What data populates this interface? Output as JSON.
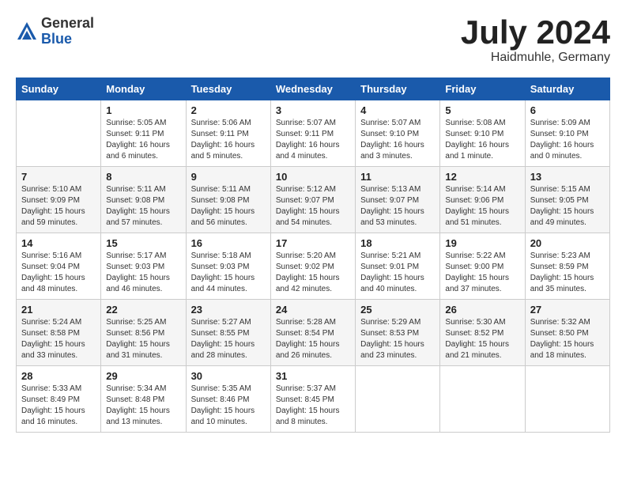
{
  "logo": {
    "general": "General",
    "blue": "Blue"
  },
  "title": {
    "month": "July 2024",
    "location": "Haidmuhle, Germany"
  },
  "headers": [
    "Sunday",
    "Monday",
    "Tuesday",
    "Wednesday",
    "Thursday",
    "Friday",
    "Saturday"
  ],
  "weeks": [
    [
      {
        "day": "",
        "info": ""
      },
      {
        "day": "1",
        "info": "Sunrise: 5:05 AM\nSunset: 9:11 PM\nDaylight: 16 hours\nand 6 minutes."
      },
      {
        "day": "2",
        "info": "Sunrise: 5:06 AM\nSunset: 9:11 PM\nDaylight: 16 hours\nand 5 minutes."
      },
      {
        "day": "3",
        "info": "Sunrise: 5:07 AM\nSunset: 9:11 PM\nDaylight: 16 hours\nand 4 minutes."
      },
      {
        "day": "4",
        "info": "Sunrise: 5:07 AM\nSunset: 9:10 PM\nDaylight: 16 hours\nand 3 minutes."
      },
      {
        "day": "5",
        "info": "Sunrise: 5:08 AM\nSunset: 9:10 PM\nDaylight: 16 hours\nand 1 minute."
      },
      {
        "day": "6",
        "info": "Sunrise: 5:09 AM\nSunset: 9:10 PM\nDaylight: 16 hours\nand 0 minutes."
      }
    ],
    [
      {
        "day": "7",
        "info": "Sunrise: 5:10 AM\nSunset: 9:09 PM\nDaylight: 15 hours\nand 59 minutes."
      },
      {
        "day": "8",
        "info": "Sunrise: 5:11 AM\nSunset: 9:08 PM\nDaylight: 15 hours\nand 57 minutes."
      },
      {
        "day": "9",
        "info": "Sunrise: 5:11 AM\nSunset: 9:08 PM\nDaylight: 15 hours\nand 56 minutes."
      },
      {
        "day": "10",
        "info": "Sunrise: 5:12 AM\nSunset: 9:07 PM\nDaylight: 15 hours\nand 54 minutes."
      },
      {
        "day": "11",
        "info": "Sunrise: 5:13 AM\nSunset: 9:07 PM\nDaylight: 15 hours\nand 53 minutes."
      },
      {
        "day": "12",
        "info": "Sunrise: 5:14 AM\nSunset: 9:06 PM\nDaylight: 15 hours\nand 51 minutes."
      },
      {
        "day": "13",
        "info": "Sunrise: 5:15 AM\nSunset: 9:05 PM\nDaylight: 15 hours\nand 49 minutes."
      }
    ],
    [
      {
        "day": "14",
        "info": "Sunrise: 5:16 AM\nSunset: 9:04 PM\nDaylight: 15 hours\nand 48 minutes."
      },
      {
        "day": "15",
        "info": "Sunrise: 5:17 AM\nSunset: 9:03 PM\nDaylight: 15 hours\nand 46 minutes."
      },
      {
        "day": "16",
        "info": "Sunrise: 5:18 AM\nSunset: 9:03 PM\nDaylight: 15 hours\nand 44 minutes."
      },
      {
        "day": "17",
        "info": "Sunrise: 5:20 AM\nSunset: 9:02 PM\nDaylight: 15 hours\nand 42 minutes."
      },
      {
        "day": "18",
        "info": "Sunrise: 5:21 AM\nSunset: 9:01 PM\nDaylight: 15 hours\nand 40 minutes."
      },
      {
        "day": "19",
        "info": "Sunrise: 5:22 AM\nSunset: 9:00 PM\nDaylight: 15 hours\nand 37 minutes."
      },
      {
        "day": "20",
        "info": "Sunrise: 5:23 AM\nSunset: 8:59 PM\nDaylight: 15 hours\nand 35 minutes."
      }
    ],
    [
      {
        "day": "21",
        "info": "Sunrise: 5:24 AM\nSunset: 8:58 PM\nDaylight: 15 hours\nand 33 minutes."
      },
      {
        "day": "22",
        "info": "Sunrise: 5:25 AM\nSunset: 8:56 PM\nDaylight: 15 hours\nand 31 minutes."
      },
      {
        "day": "23",
        "info": "Sunrise: 5:27 AM\nSunset: 8:55 PM\nDaylight: 15 hours\nand 28 minutes."
      },
      {
        "day": "24",
        "info": "Sunrise: 5:28 AM\nSunset: 8:54 PM\nDaylight: 15 hours\nand 26 minutes."
      },
      {
        "day": "25",
        "info": "Sunrise: 5:29 AM\nSunset: 8:53 PM\nDaylight: 15 hours\nand 23 minutes."
      },
      {
        "day": "26",
        "info": "Sunrise: 5:30 AM\nSunset: 8:52 PM\nDaylight: 15 hours\nand 21 minutes."
      },
      {
        "day": "27",
        "info": "Sunrise: 5:32 AM\nSunset: 8:50 PM\nDaylight: 15 hours\nand 18 minutes."
      }
    ],
    [
      {
        "day": "28",
        "info": "Sunrise: 5:33 AM\nSunset: 8:49 PM\nDaylight: 15 hours\nand 16 minutes."
      },
      {
        "day": "29",
        "info": "Sunrise: 5:34 AM\nSunset: 8:48 PM\nDaylight: 15 hours\nand 13 minutes."
      },
      {
        "day": "30",
        "info": "Sunrise: 5:35 AM\nSunset: 8:46 PM\nDaylight: 15 hours\nand 10 minutes."
      },
      {
        "day": "31",
        "info": "Sunrise: 5:37 AM\nSunset: 8:45 PM\nDaylight: 15 hours\nand 8 minutes."
      },
      {
        "day": "",
        "info": ""
      },
      {
        "day": "",
        "info": ""
      },
      {
        "day": "",
        "info": ""
      }
    ]
  ]
}
